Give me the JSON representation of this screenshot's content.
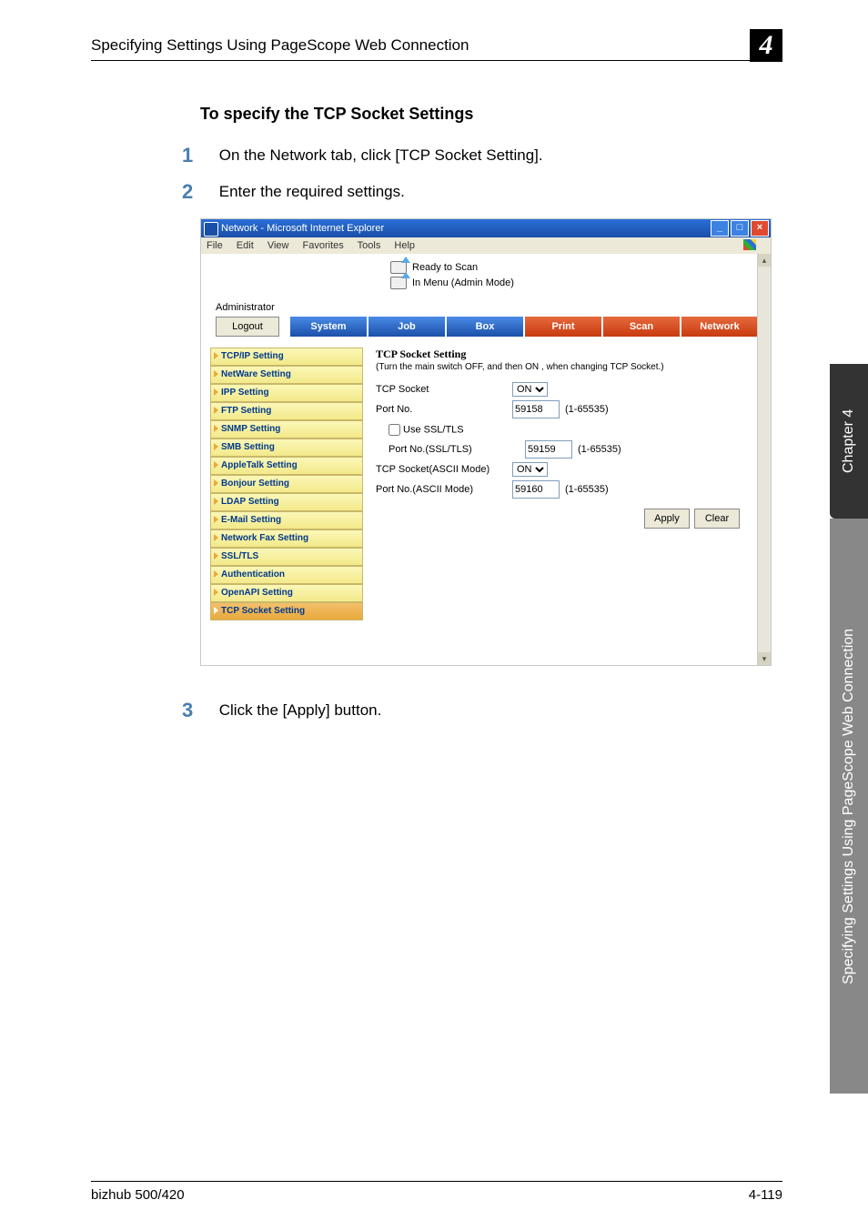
{
  "header": {
    "title": "Specifying Settings Using PageScope Web Connection",
    "chapter_num": "4"
  },
  "section_title": "To specify the TCP Socket Settings",
  "steps": {
    "s1_num": "1",
    "s1": "On the Network tab, click [TCP Socket Setting].",
    "s2_num": "2",
    "s2": "Enter the required settings.",
    "s3_num": "3",
    "s3": "Click the [Apply] button."
  },
  "ie": {
    "title": "Network - Microsoft Internet Explorer",
    "menu": {
      "file": "File",
      "edit": "Edit",
      "view": "View",
      "fav": "Favorites",
      "tools": "Tools",
      "help": "Help"
    },
    "status_ready": "Ready to Scan",
    "status_mode": "In Menu (Admin Mode)",
    "admin": "Administrator",
    "logout": "Logout",
    "tabs": {
      "system": "System",
      "job": "Job",
      "box": "Box",
      "print": "Print",
      "scan": "Scan",
      "network": "Network"
    },
    "side": [
      "TCP/IP Setting",
      "NetWare Setting",
      "IPP Setting",
      "FTP Setting",
      "SNMP Setting",
      "SMB Setting",
      "AppleTalk Setting",
      "Bonjour Setting",
      "LDAP Setting",
      "E-Mail Setting",
      "Network Fax Setting",
      "SSL/TLS",
      "Authentication",
      "OpenAPI Setting",
      "TCP Socket Setting"
    ],
    "selected_index": 14,
    "form": {
      "title": "TCP Socket Setting",
      "note": "(Turn the main switch OFF, and then ON , when changing TCP Socket.)",
      "tcp_label": "TCP Socket",
      "tcp_val": "ON",
      "port_label": "Port No.",
      "port_val": "59158",
      "range": "(1-65535)",
      "ssl_label": "Use SSL/TLS",
      "sslport_label": "Port No.(SSL/TLS)",
      "sslport_val": "59159",
      "ascii_label": "TCP Socket(ASCII Mode)",
      "ascii_val": "ON",
      "asciiport_label": "Port No.(ASCII Mode)",
      "asciiport_val": "59160",
      "apply": "Apply",
      "clear": "Clear"
    }
  },
  "vtab": {
    "ch": "Chapter 4",
    "long": "Specifying Settings Using PageScope Web Connection"
  },
  "footer": {
    "model": "bizhub 500/420",
    "page": "4-119"
  }
}
